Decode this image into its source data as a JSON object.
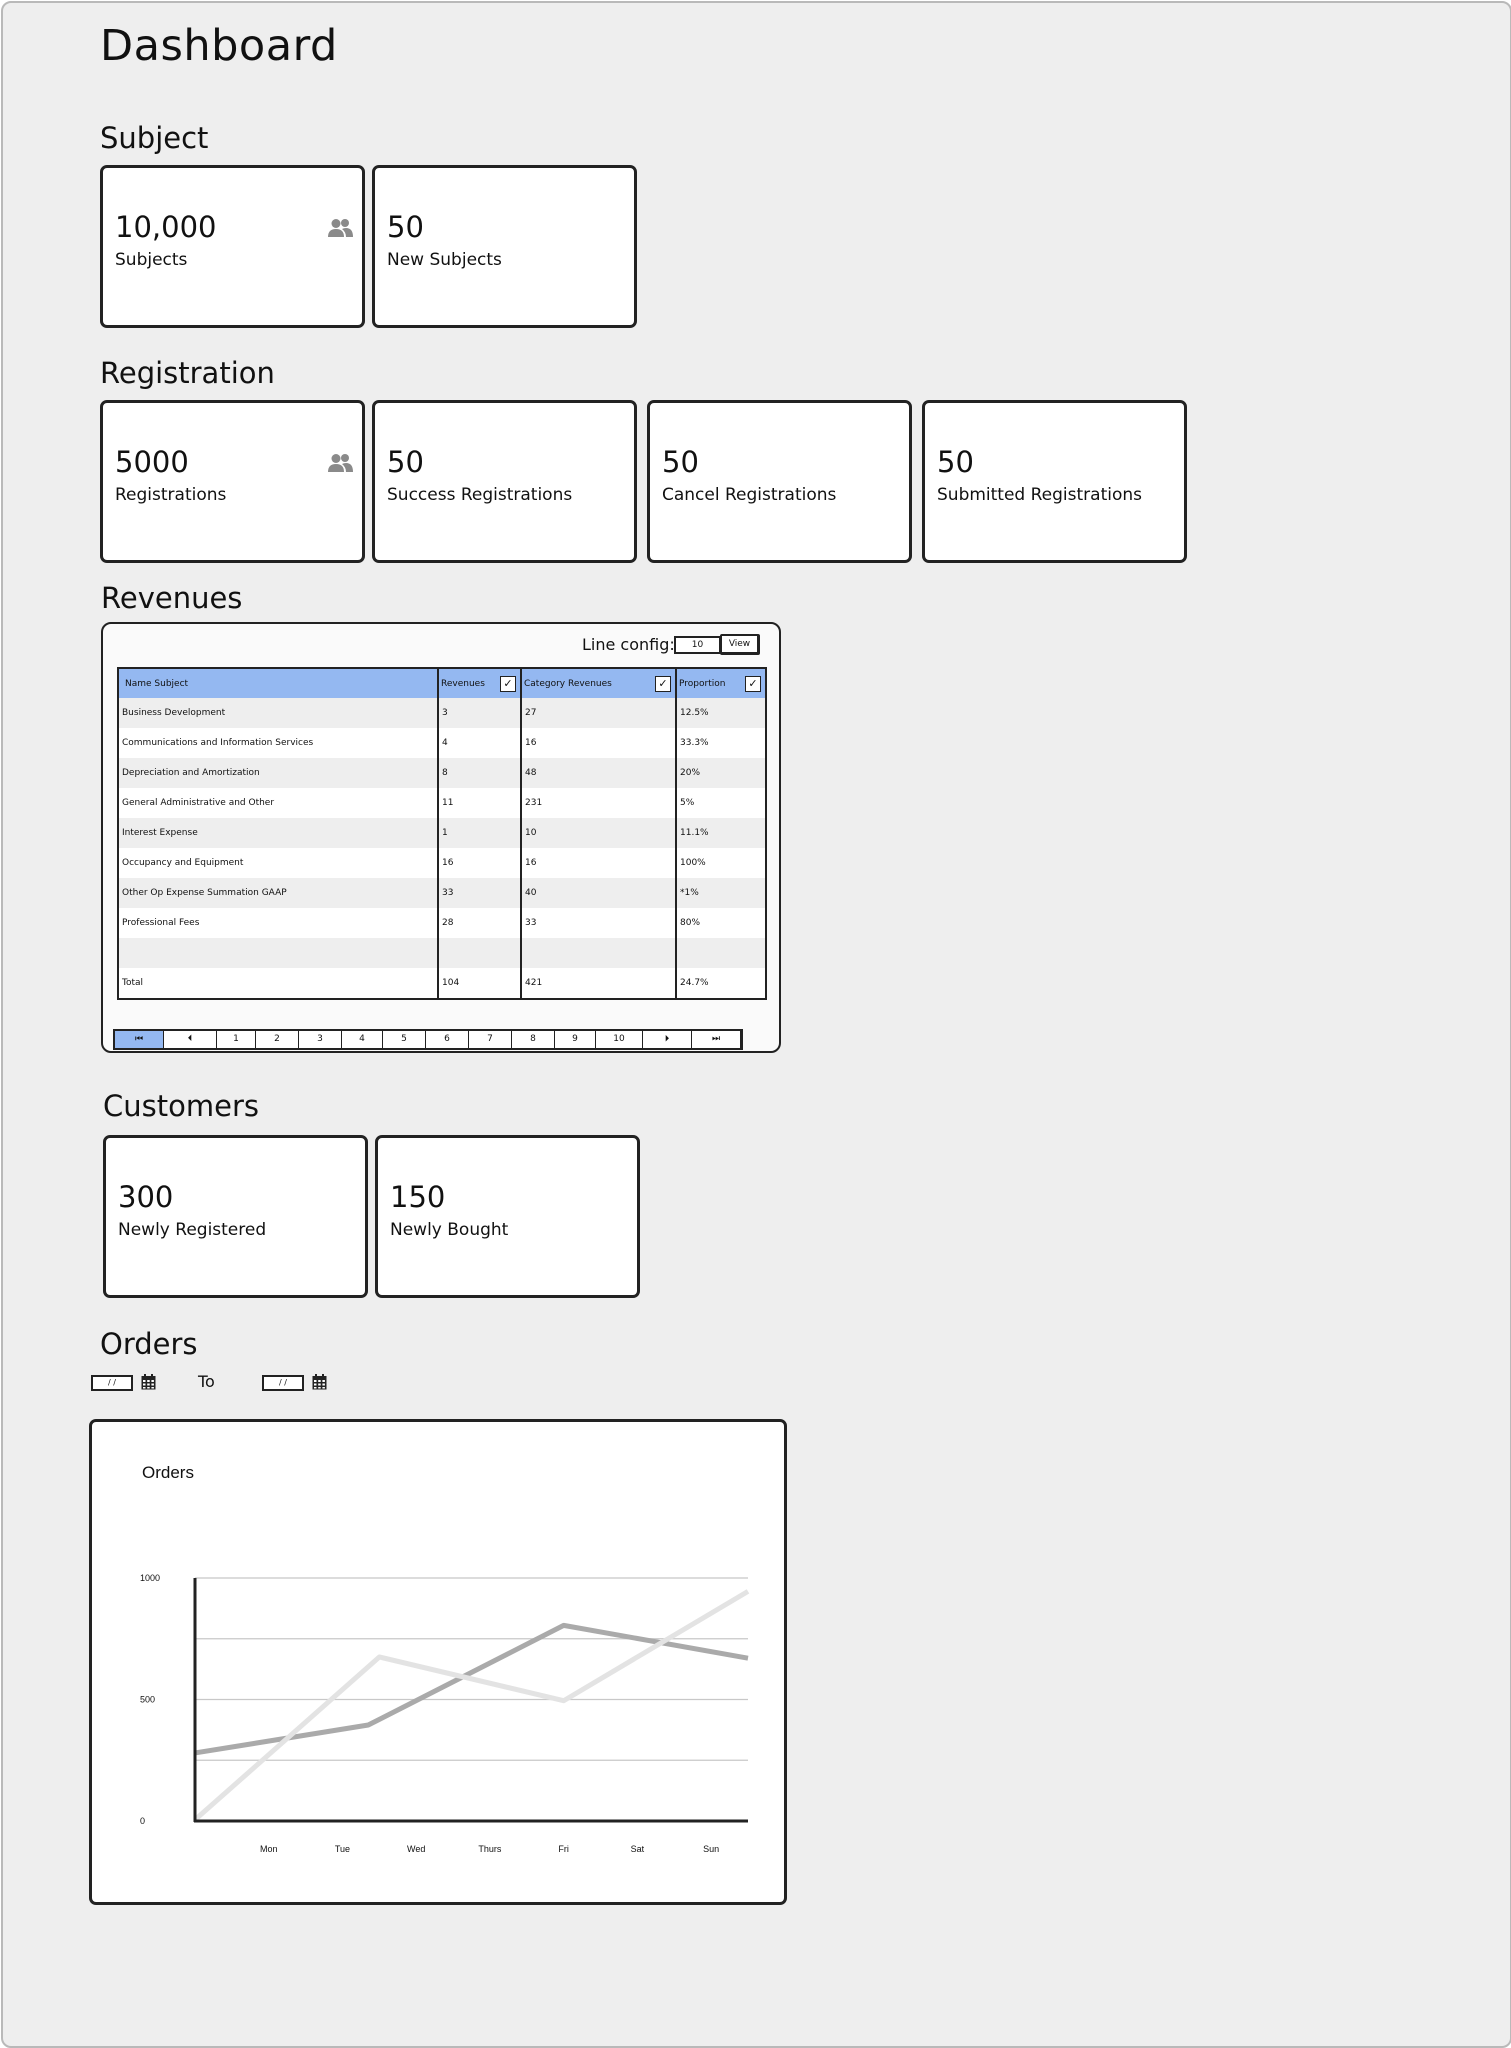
{
  "page_title": "Dashboard",
  "subject": {
    "title": "Subject",
    "cards": [
      {
        "value": "10,000",
        "label": "Subjects",
        "icon": "users-icon"
      },
      {
        "value": "50",
        "label": "New Subjects"
      }
    ]
  },
  "registration": {
    "title": "Registration",
    "cards": [
      {
        "value": "5000",
        "label": "Registrations",
        "icon": "users-icon"
      },
      {
        "value": "50",
        "label": "Success Registrations"
      },
      {
        "value": "50",
        "label": "Cancel Registrations"
      },
      {
        "value": "50",
        "label": "Submitted Registrations"
      }
    ]
  },
  "revenues": {
    "title": "Revenues",
    "line_config_label": "Line config:",
    "line_config_value": "10",
    "view_button": "View",
    "columns": [
      "Name Subject",
      "Revenues",
      "Category Revenues",
      "Proportion"
    ],
    "rows": [
      [
        "Business Development",
        "3",
        "27",
        "12.5%"
      ],
      [
        "Communications and Information Services",
        "4",
        "16",
        "33.3%"
      ],
      [
        "Depreciation and Amortization",
        "8",
        "48",
        "20%"
      ],
      [
        "General Administrative and Other",
        "11",
        "231",
        "5%"
      ],
      [
        "Interest Expense",
        "1",
        "10",
        "11.1%"
      ],
      [
        "Occupancy and Equipment",
        "16",
        "16",
        "100%"
      ],
      [
        "Other Op Expense Summation GAAP",
        "33",
        "40",
        "*1%"
      ],
      [
        "Professional Fees",
        "28",
        "33",
        "80%"
      ],
      [
        "",
        "",
        "",
        ""
      ],
      [
        "Total",
        "104",
        "421",
        "24.7%"
      ]
    ],
    "pagination": [
      "⏮",
      "⏴",
      "1",
      "2",
      "3",
      "4",
      "5",
      "6",
      "7",
      "8",
      "9",
      "10",
      "⏵",
      "⏭"
    ]
  },
  "customers": {
    "title": "Customers",
    "cards": [
      {
        "value": "300",
        "label": "Newly Registered"
      },
      {
        "value": "150",
        "label": "Newly Bought"
      }
    ]
  },
  "orders": {
    "title": "Orders",
    "date_from_placeholder": "/ /",
    "to_label": "To",
    "date_to_placeholder": "/ /"
  },
  "chart_data": {
    "type": "line",
    "title": "Orders",
    "xlabel": "",
    "ylabel": "",
    "categories": [
      "",
      "Mon",
      "Tue",
      "Wed",
      "Thurs",
      "Fri",
      "Sat",
      "Sun"
    ],
    "yticks": [
      0,
      500,
      1000
    ],
    "ylim": [
      0,
      1000
    ],
    "grid": true,
    "series": [
      {
        "color": "#aaaaaa",
        "points": [
          [
            0,
            280
          ],
          [
            2.35,
            395
          ],
          [
            5,
            805
          ],
          [
            7.5,
            670
          ]
        ]
      },
      {
        "color": "#e3e3e3",
        "points": [
          [
            0,
            5
          ],
          [
            2.5,
            675
          ],
          [
            5,
            495
          ],
          [
            7.5,
            945
          ]
        ]
      }
    ]
  }
}
